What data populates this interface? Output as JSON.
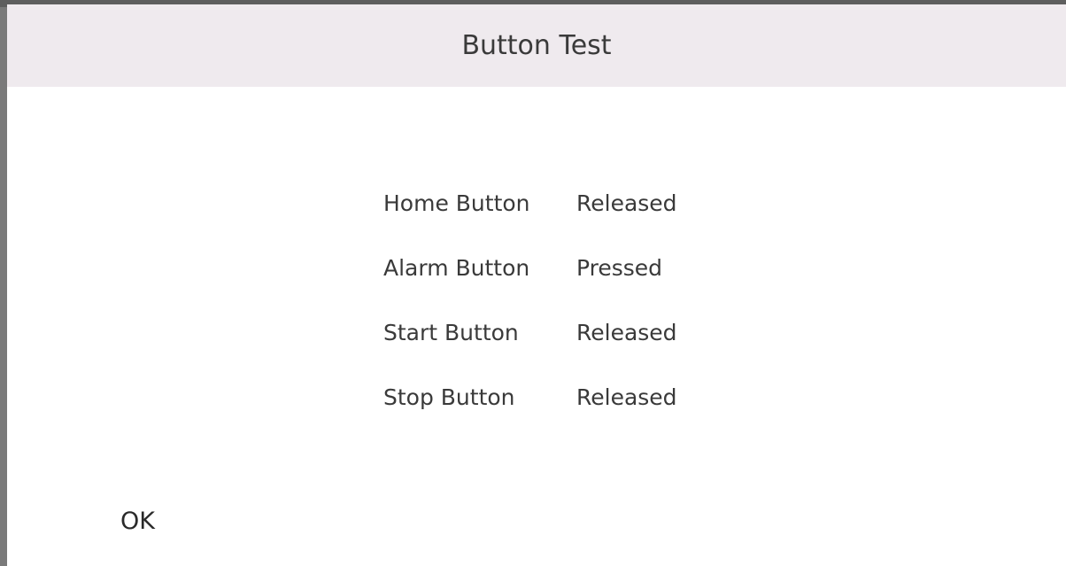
{
  "dialog": {
    "title": "Button Test",
    "rows": [
      {
        "label": "Home Button",
        "state": "Released"
      },
      {
        "label": "Alarm Button",
        "state": "Pressed"
      },
      {
        "label": "Start Button",
        "state": "Released"
      },
      {
        "label": "Stop Button",
        "state": "Released"
      }
    ],
    "ok_label": "OK"
  },
  "colors": {
    "header_background": "#efeaee",
    "dialog_background": "#ffffff",
    "text": "#3a3a3a"
  }
}
